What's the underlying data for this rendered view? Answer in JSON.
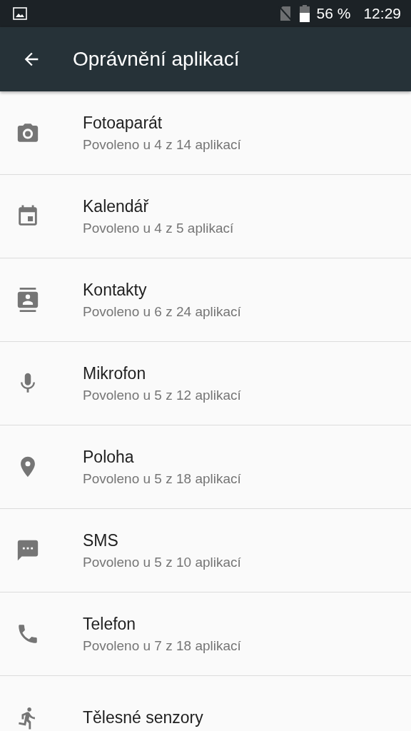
{
  "status_bar": {
    "battery": "56 %",
    "time": "12:29"
  },
  "toolbar": {
    "title": "Oprávnění aplikací"
  },
  "permissions": [
    {
      "kind": "camera",
      "title": "Fotoaparát",
      "subtitle": "Povoleno u 4 z 14 aplikací"
    },
    {
      "kind": "calendar",
      "title": "Kalendář",
      "subtitle": "Povoleno u 4 z 5 aplikací"
    },
    {
      "kind": "contacts",
      "title": "Kontakty",
      "subtitle": "Povoleno u 6 z 24 aplikací"
    },
    {
      "kind": "microphone",
      "title": "Mikrofon",
      "subtitle": "Povoleno u 5 z 12 aplikací"
    },
    {
      "kind": "location",
      "title": "Poloha",
      "subtitle": "Povoleno u 5 z 18 aplikací"
    },
    {
      "kind": "sms",
      "title": "SMS",
      "subtitle": "Povoleno u 5 z 10 aplikací"
    },
    {
      "kind": "phone",
      "title": "Telefon",
      "subtitle": "Povoleno u 7 z 18 aplikací"
    },
    {
      "kind": "sensors",
      "title": "Tělesné senzory"
    }
  ]
}
